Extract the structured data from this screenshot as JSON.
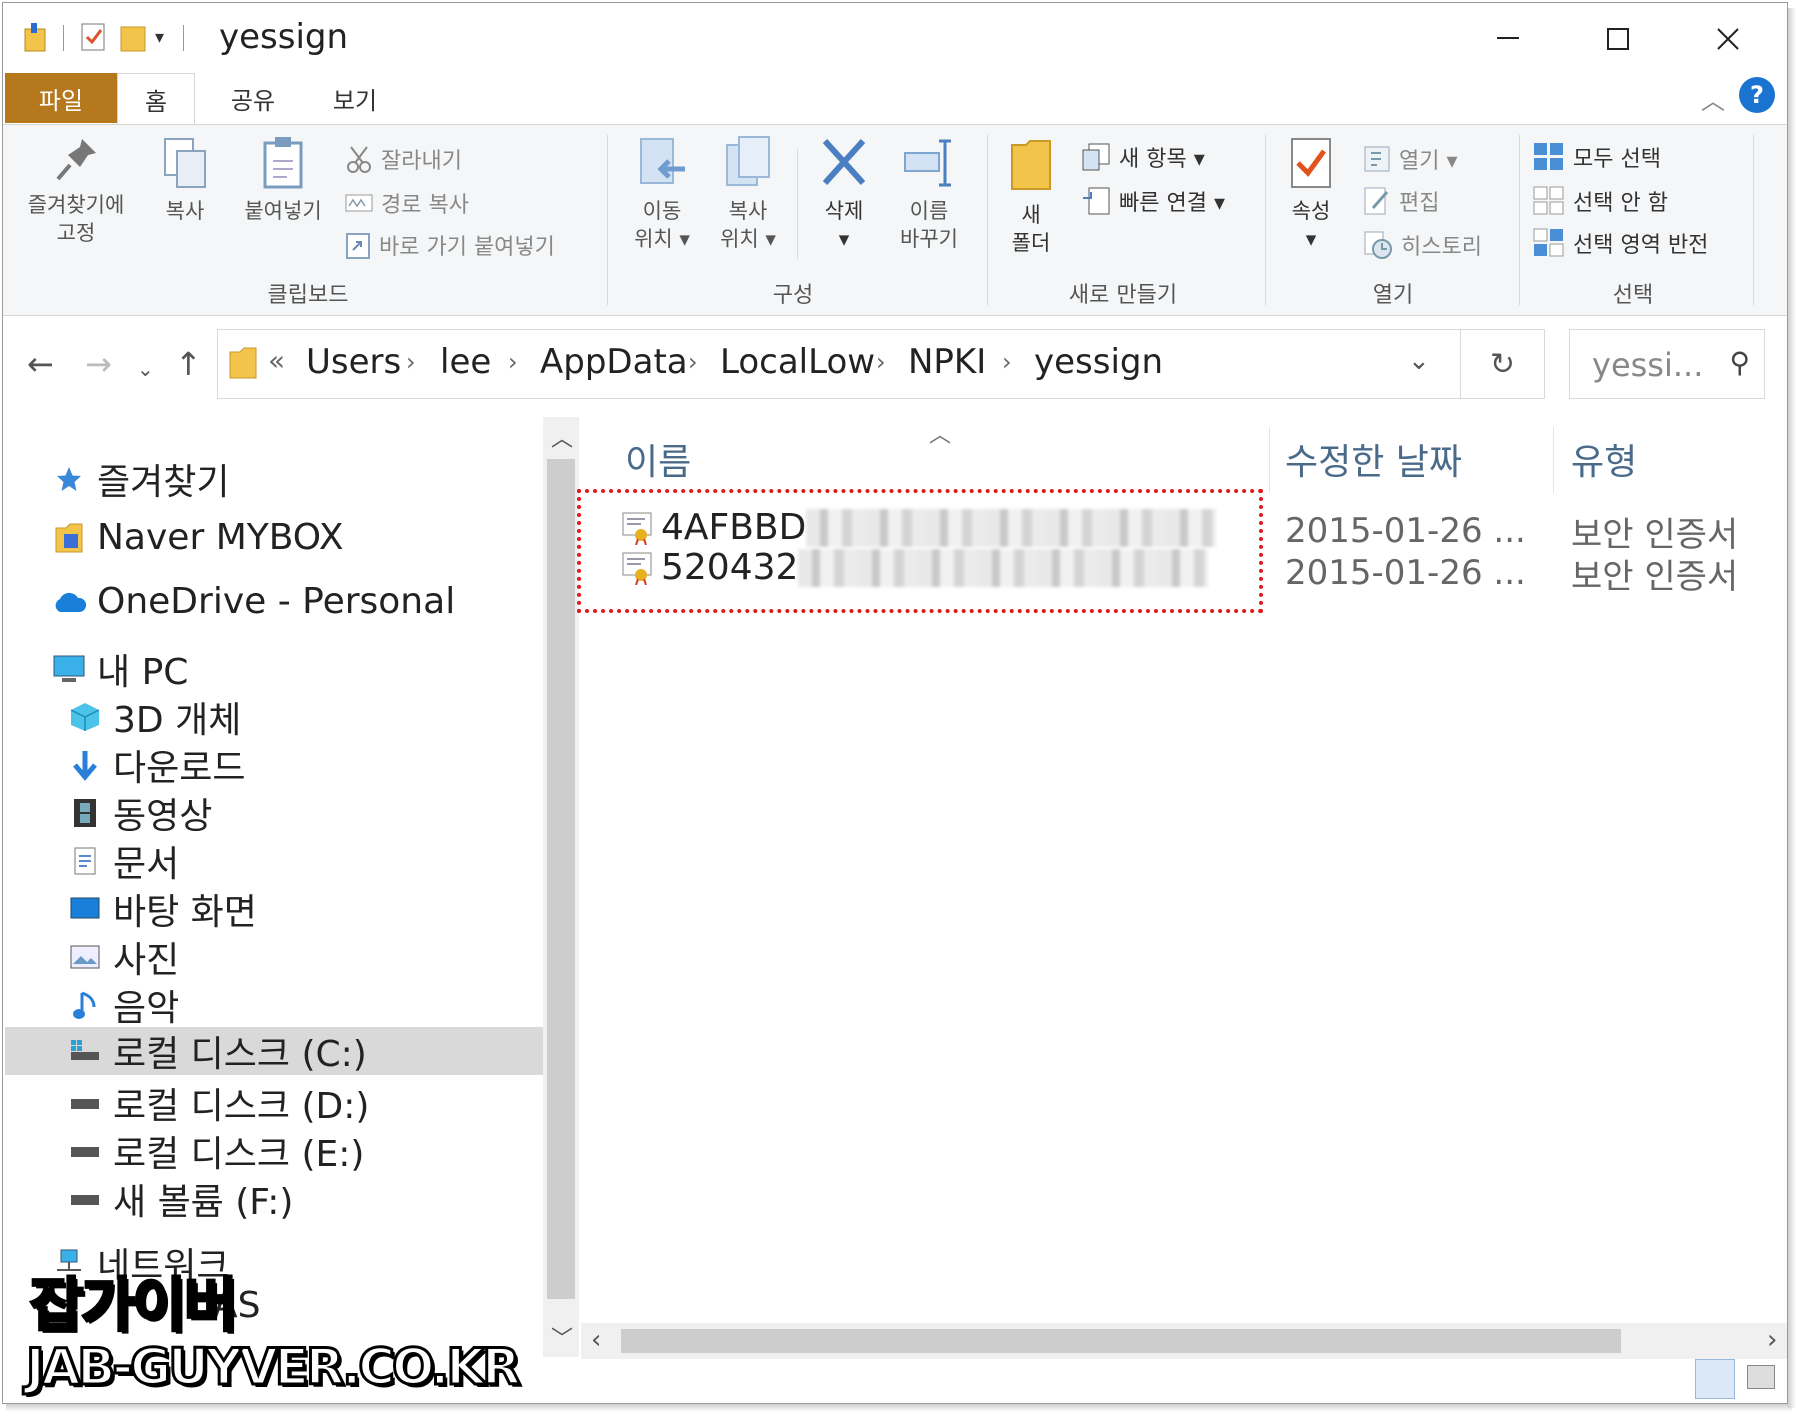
{
  "window": {
    "title": "yessign"
  },
  "ribbon_tabs": {
    "file": "파일",
    "home": "홈",
    "share": "공유",
    "view": "보기"
  },
  "ribbon": {
    "clipboard": {
      "label": "클립보드",
      "pin_line1": "즐겨찾기에",
      "pin_line2": "고정",
      "copy": "복사",
      "paste": "붙여넣기",
      "cut": "잘라내기",
      "copy_path": "경로 복사",
      "paste_shortcut": "바로 가기 붙여넣기"
    },
    "organize": {
      "label": "구성",
      "move_line1": "이동",
      "move_line2": "위치 ▾",
      "copyto_line1": "복사",
      "copyto_line2": "위치 ▾",
      "delete": "삭제",
      "delete_arrow": "▾",
      "rename_line1": "이름",
      "rename_line2": "바꾸기"
    },
    "new": {
      "label": "새로 만들기",
      "new_folder_line1": "새",
      "new_folder_line2": "폴더",
      "new_item": "새 항목 ▾",
      "easy_access": "빠른 연결 ▾"
    },
    "open": {
      "label": "열기",
      "properties": "속성",
      "properties_arrow": "▾",
      "open": "열기 ▾",
      "edit": "편집",
      "history": "히스토리"
    },
    "select": {
      "label": "선택",
      "select_all": "모두 선택",
      "select_none": "선택 안 함",
      "invert": "선택 영역 반전"
    }
  },
  "address": {
    "overflow": "«",
    "crumbs": [
      "Users",
      "lee",
      "AppData",
      "LocalLow",
      "NPKI",
      "yessign"
    ],
    "search_placeholder": "yessi..."
  },
  "nav_pane": {
    "quick_access": "즐겨찾기",
    "mybox": "Naver MYBOX",
    "onedrive": "OneDrive - Personal",
    "this_pc": "내 PC",
    "objects_3d": "3D 개체",
    "downloads": "다운로드",
    "videos": "동영상",
    "documents": "문서",
    "desktop": "바탕 화면",
    "pictures": "사진",
    "music": "음악",
    "drive_c": "로컬 디스크 (C:)",
    "drive_d": "로컬 디스크 (D:)",
    "drive_e": "로컬 디스크 (E:)",
    "drive_f": "새 볼륨 (F:)",
    "network": "네트워크",
    "nas": "AS"
  },
  "columns": {
    "name": "이름",
    "modified": "수정한 날짜",
    "type": "유형"
  },
  "files": [
    {
      "name": "4AFBBD",
      "date": "2015-01-26 ...",
      "type": "보안 인증서"
    },
    {
      "name": "520432",
      "date": "2015-01-26 ...",
      "type": "보안 인증서"
    }
  ],
  "watermark": {
    "line1": "잡가이버",
    "line2": "JAB-GUYVER.CO.KR"
  },
  "colors": {
    "file_tab": "#b5781d",
    "highlight": "#e01919",
    "help": "#1a73d1"
  }
}
